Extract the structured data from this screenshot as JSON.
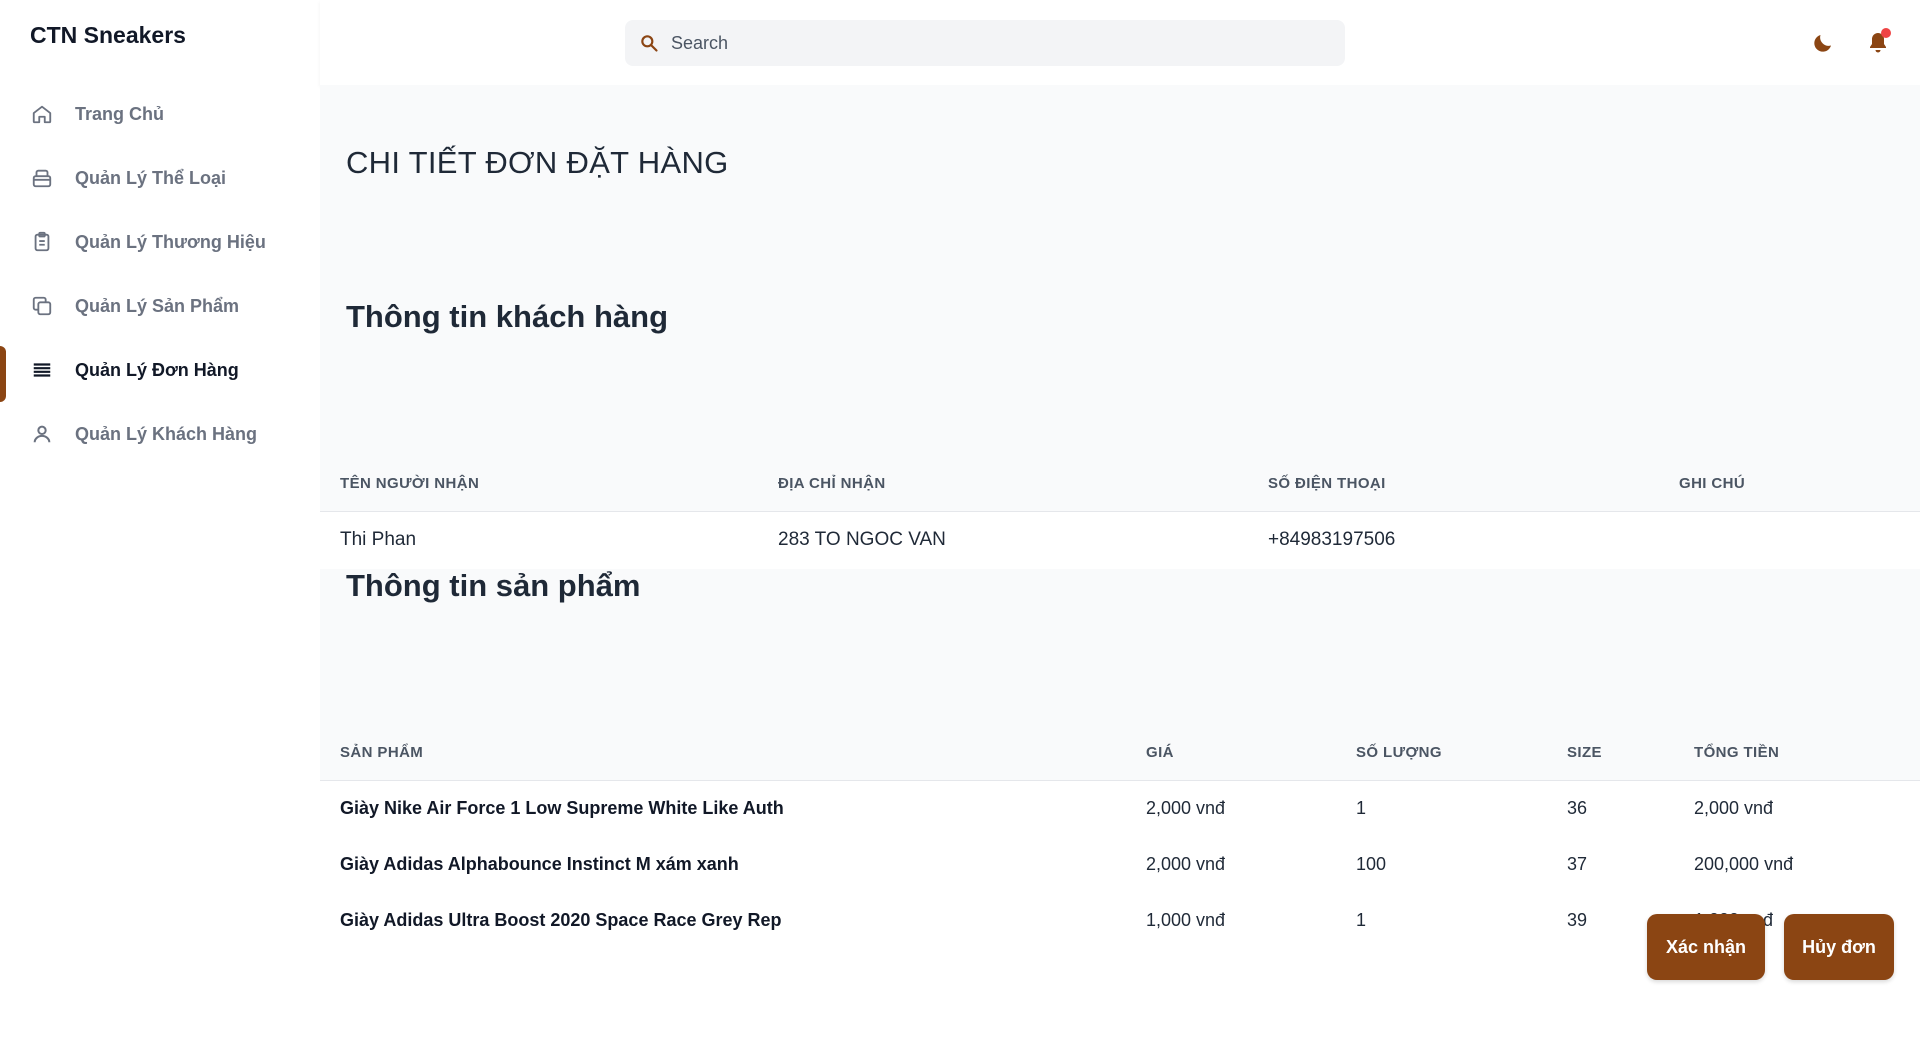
{
  "brand": "CTN Sneakers",
  "sidebar": {
    "items": [
      {
        "label": "Trang Chủ",
        "icon": "home-icon"
      },
      {
        "label": "Quản Lý Thể Loại",
        "icon": "box-icon"
      },
      {
        "label": "Quản Lý Thương Hiệu",
        "icon": "clipboard-icon"
      },
      {
        "label": "Quản Lý Sản Phẩm",
        "icon": "copy-icon"
      },
      {
        "label": "Quản Lý Đơn Hàng",
        "icon": "list-icon",
        "active": true
      },
      {
        "label": "Quản Lý Khách Hàng",
        "icon": "user-icon"
      }
    ]
  },
  "header": {
    "search_placeholder": "Search"
  },
  "page": {
    "title": "CHI TIẾT ĐƠN ĐẶT HÀNG",
    "customer_section": "Thông tin khách hàng",
    "product_section": "Thông tin sản phẩm"
  },
  "customer_table": {
    "headers": [
      "TÊN NGƯỜI NHẬN",
      "ĐỊA CHỈ NHẬN",
      "SỐ ĐIỆN THOẠI",
      "GHI CHÚ"
    ],
    "row": [
      "Thi Phan",
      "283 TO NGOC VAN",
      "+84983197506",
      ""
    ]
  },
  "product_table": {
    "headers": [
      "SẢN PHẨM",
      "GIÁ",
      "SỐ LƯỢNG",
      "SIZE",
      "TỔNG TIỀN"
    ],
    "rows": [
      [
        "Giày Nike Air Force 1 Low Supreme White Like Auth",
        "2,000 vnđ",
        "1",
        "36",
        "2,000 vnđ"
      ],
      [
        "Giày Adidas Alphabounce Instinct M xám xanh",
        "2,000 vnđ",
        "100",
        "37",
        "200,000 vnđ"
      ],
      [
        "Giày Adidas Ultra Boost 2020 Space Race Grey Rep",
        "1,000 vnđ",
        "1",
        "39",
        "1,000 vnđ"
      ]
    ]
  },
  "actions": {
    "confirm": "Xác nhận",
    "cancel": "Hủy đơn"
  },
  "colors": {
    "accent": "#8b4513",
    "notification_dot": "#ef4444"
  }
}
